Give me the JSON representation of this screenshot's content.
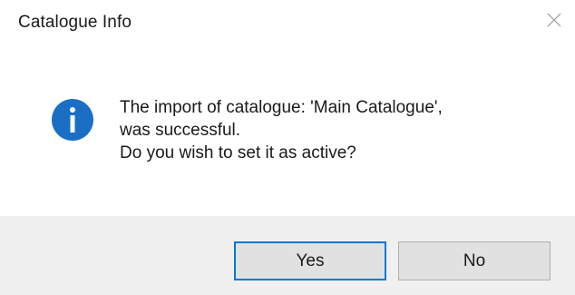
{
  "window": {
    "title": "Catalogue Info",
    "close_icon": "close-icon"
  },
  "message": {
    "icon": "info-icon",
    "icon_color": "#1a6fc4",
    "lines": [
      "The import of catalogue: 'Main Catalogue',",
      "was successful.",
      "Do you wish to set it as active?"
    ]
  },
  "buttons": {
    "yes_label": "Yes",
    "no_label": "No",
    "default_border_color": "#0078d7"
  }
}
